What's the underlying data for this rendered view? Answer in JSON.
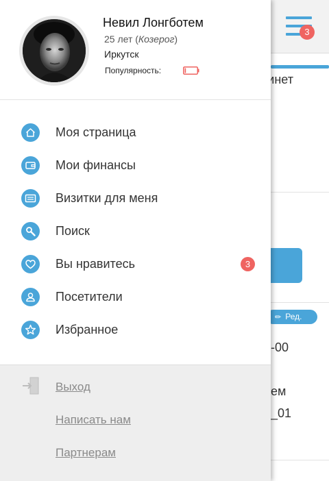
{
  "background": {
    "menu_badge": "3",
    "fragments": [
      "бинет",
      "-00",
      "ем",
      "_01"
    ],
    "edit_label": "Ред."
  },
  "profile": {
    "name": "Невил Лонгботем",
    "age_prefix": "25 лет (",
    "zodiac": "Козерог",
    "age_suffix": ")",
    "city": "Иркутск",
    "popularity_label": "Популярность:",
    "popularity_level": 0.1
  },
  "menu": {
    "items": [
      {
        "label": "Моя страница",
        "icon": "home-icon"
      },
      {
        "label": "Мои финансы",
        "icon": "wallet-icon"
      },
      {
        "label": "Визитки для меня",
        "icon": "card-icon"
      },
      {
        "label": "Поиск",
        "icon": "search-icon"
      },
      {
        "label": "Вы нравитесь",
        "icon": "heart-icon",
        "badge": "3"
      },
      {
        "label": "Посетители",
        "icon": "person-icon"
      },
      {
        "label": "Избранное",
        "icon": "star-icon"
      }
    ]
  },
  "footer": {
    "exit_label": "Выход",
    "write_label": "Написать нам",
    "partners_label": "Партнерам"
  },
  "colors": {
    "accent": "#4aa5d9",
    "badge": "#ef6461",
    "footer_bg": "#eeeeee"
  }
}
